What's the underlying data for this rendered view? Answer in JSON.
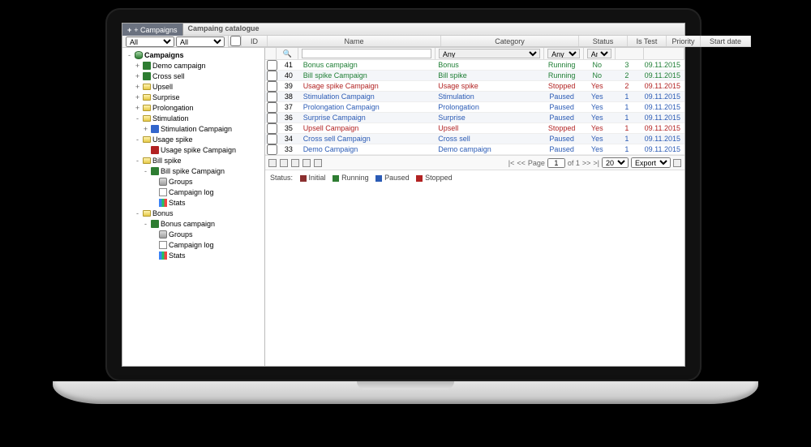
{
  "header": {
    "add_campaign_btn": "+ Campaigns",
    "panel_title": "Campaing catalogue",
    "filter1_value": "All",
    "filter2_value": "All"
  },
  "tree": {
    "root_label": "Campaigns",
    "nodes": [
      {
        "exp": "+",
        "icon": "run",
        "label": "Demo campaign",
        "indent": 1
      },
      {
        "exp": "+",
        "icon": "run",
        "label": "Cross sell",
        "indent": 1
      },
      {
        "exp": "+",
        "icon": "folder",
        "label": "Upsell",
        "indent": 1
      },
      {
        "exp": "+",
        "icon": "folder",
        "label": "Surprise",
        "indent": 1
      },
      {
        "exp": "+",
        "icon": "folder",
        "label": "Prolongation",
        "indent": 1
      },
      {
        "exp": "-",
        "icon": "folder",
        "label": "Stimulation",
        "indent": 1
      },
      {
        "exp": "+",
        "icon": "paused",
        "label": "Stimulation Campaign",
        "indent": 2
      },
      {
        "exp": "-",
        "icon": "folder",
        "label": "Usage spike",
        "indent": 1
      },
      {
        "exp": "",
        "icon": "stopped",
        "label": "Usage spike Campaign",
        "indent": 2
      },
      {
        "exp": "-",
        "icon": "folder",
        "label": "Bill spike",
        "indent": 1
      },
      {
        "exp": "-",
        "icon": "run",
        "label": "Bill spike Campaign",
        "indent": 2
      },
      {
        "exp": "",
        "icon": "groups",
        "label": "Groups",
        "indent": 3
      },
      {
        "exp": "",
        "icon": "page",
        "label": "Campaign log",
        "indent": 3
      },
      {
        "exp": "",
        "icon": "stats",
        "label": "Stats",
        "indent": 3
      },
      {
        "exp": "-",
        "icon": "folder",
        "label": "Bonus",
        "indent": 1
      },
      {
        "exp": "-",
        "icon": "run",
        "label": "Bonus campaign",
        "indent": 2
      },
      {
        "exp": "",
        "icon": "groups",
        "label": "Groups",
        "indent": 3
      },
      {
        "exp": "",
        "icon": "page",
        "label": "Campaign log",
        "indent": 3
      },
      {
        "exp": "",
        "icon": "stats",
        "label": "Stats",
        "indent": 3
      }
    ]
  },
  "grid": {
    "columns": {
      "id": "ID",
      "name": "Name",
      "cat": "Category",
      "status": "Status",
      "test": "Is Test",
      "pri": "Priority",
      "date": "Start date"
    },
    "filters": {
      "name": "",
      "cat": "Any",
      "status": "Any",
      "test": "Any"
    },
    "rows": [
      {
        "id": "41",
        "name": "Bonus campaign",
        "cat": "Bonus",
        "status": "Running",
        "test": "No",
        "pri": "3",
        "date": "09.11.2015"
      },
      {
        "id": "40",
        "name": "Bill spike Campaign",
        "cat": "Bill spike",
        "status": "Running",
        "test": "No",
        "pri": "2",
        "date": "09.11.2015"
      },
      {
        "id": "39",
        "name": "Usage spike Campaign",
        "cat": "Usage spike",
        "status": "Stopped",
        "test": "Yes",
        "pri": "2",
        "date": "09.11.2015"
      },
      {
        "id": "38",
        "name": "Stimulation Campaign",
        "cat": "Stimulation",
        "status": "Paused",
        "test": "Yes",
        "pri": "1",
        "date": "09.11.2015"
      },
      {
        "id": "37",
        "name": "Prolongation Campaign",
        "cat": "Prolongation",
        "status": "Paused",
        "test": "Yes",
        "pri": "1",
        "date": "09.11.2015"
      },
      {
        "id": "36",
        "name": "Surprise Campaign",
        "cat": "Surprise",
        "status": "Paused",
        "test": "Yes",
        "pri": "1",
        "date": "09.11.2015"
      },
      {
        "id": "35",
        "name": "Upsell Campaign",
        "cat": "Upsell",
        "status": "Stopped",
        "test": "Yes",
        "pri": "1",
        "date": "09.11.2015"
      },
      {
        "id": "34",
        "name": "Cross sell Campaign",
        "cat": "Cross sell",
        "status": "Paused",
        "test": "Yes",
        "pri": "1",
        "date": "09.11.2015"
      },
      {
        "id": "33",
        "name": "Demo Campaign",
        "cat": "Demo campaign",
        "status": "Paused",
        "test": "Yes",
        "pri": "1",
        "date": "09.11.2015"
      }
    ]
  },
  "pager": {
    "page_label": "Page",
    "page": "1",
    "of": "of 1",
    "size": "20",
    "export": "Export"
  },
  "legend": {
    "label": "Status:",
    "initial": "Initial",
    "running": "Running",
    "paused": "Paused",
    "stopped": "Stopped"
  }
}
